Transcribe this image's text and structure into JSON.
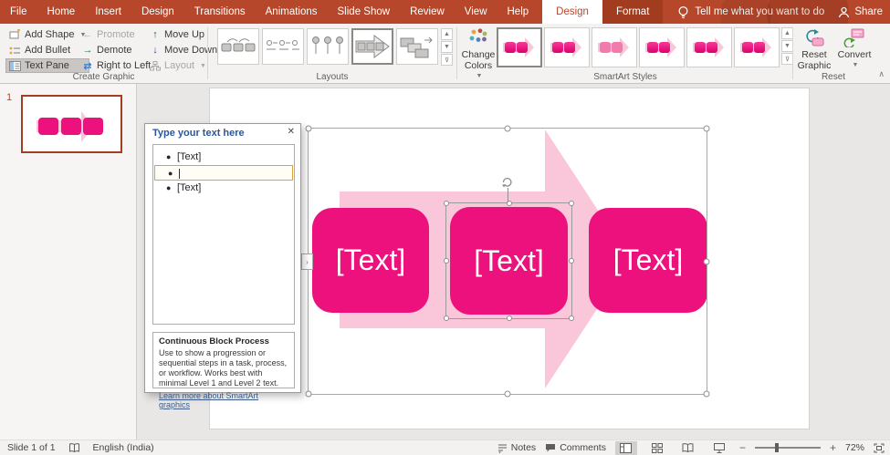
{
  "menu": {
    "tabs": [
      "File",
      "Home",
      "Insert",
      "Design",
      "Transitions",
      "Animations",
      "Slide Show",
      "Review",
      "View",
      "Help"
    ],
    "contextual": {
      "design": "Design",
      "format": "Format"
    },
    "tell_me": "Tell me what you want to do",
    "share": "Share"
  },
  "ribbon": {
    "create_graphic": {
      "label": "Create Graphic",
      "add_shape": "Add Shape",
      "add_bullet": "Add Bullet",
      "text_pane": "Text Pane",
      "promote": "Promote",
      "demote": "Demote",
      "right_to_left": "Right to Left",
      "move_up": "Move Up",
      "move_down": "Move Down",
      "layout": "Layout"
    },
    "layouts": {
      "label": "Layouts"
    },
    "smartart_styles": {
      "label": "SmartArt Styles",
      "change_colors": "Change Colors"
    },
    "reset": {
      "label": "Reset",
      "reset_graphic": "Reset Graphic",
      "convert": "Convert"
    }
  },
  "slide_panel": {
    "slide_number": "1"
  },
  "text_pane": {
    "title": "Type your text here",
    "items": [
      "[Text]",
      "",
      "[Text]"
    ],
    "info_title": "Continuous Block Process",
    "info_body": "Use to show a progression or sequential steps in a task, process, or workflow. Works best with minimal Level 1 and Level 2 text.",
    "info_link": "Learn more about SmartArt graphics"
  },
  "slide": {
    "shapes": [
      {
        "label": "[Text]"
      },
      {
        "label": "[Text]"
      },
      {
        "label": "[Text]"
      }
    ]
  },
  "status_bar": {
    "slide_indicator": "Slide 1 of 1",
    "language": "English (India)",
    "notes": "Notes",
    "comments": "Comments",
    "zoom_level": "72%"
  },
  "colors": {
    "ribbon_red": "#B7472A",
    "hot_pink": "#EC117C",
    "light_pink": "#F9C6DA",
    "selection_orange": "#D8A33A",
    "text_pane_header_blue": "#2B579A"
  }
}
